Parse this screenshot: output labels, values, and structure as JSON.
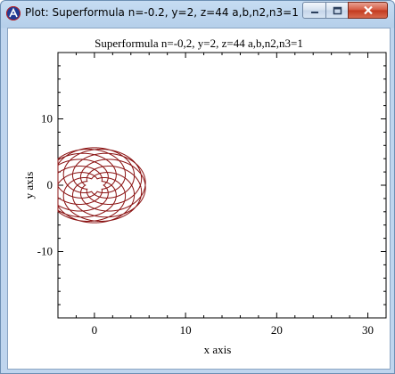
{
  "window": {
    "title": "Plot: Superformula n=-0.2, y=2, z=44 a,b,n2,n3=1",
    "icon": "app-icon"
  },
  "controls": {
    "minimize_icon": "minimize-icon",
    "maximize_icon": "maximize-icon",
    "close_icon": "close-icon"
  },
  "chart_data": {
    "type": "line",
    "title": "Superformula n=-0,2, y=2, z=44 a,b,n2,n3=1",
    "xlabel": "x axis",
    "ylabel": "y axis",
    "x_ticks": [
      0,
      10,
      20,
      30
    ],
    "y_ticks": [
      -10,
      0,
      10
    ],
    "xlim": [
      -4,
      32
    ],
    "ylim": [
      -20,
      20
    ],
    "series": [
      {
        "formula": "superformula",
        "params": {
          "m": 2,
          "z": 44,
          "n1": -0.2,
          "a": 1,
          "b": 1,
          "n2": 1,
          "n3": 1
        },
        "color": "#8b1414"
      }
    ]
  }
}
